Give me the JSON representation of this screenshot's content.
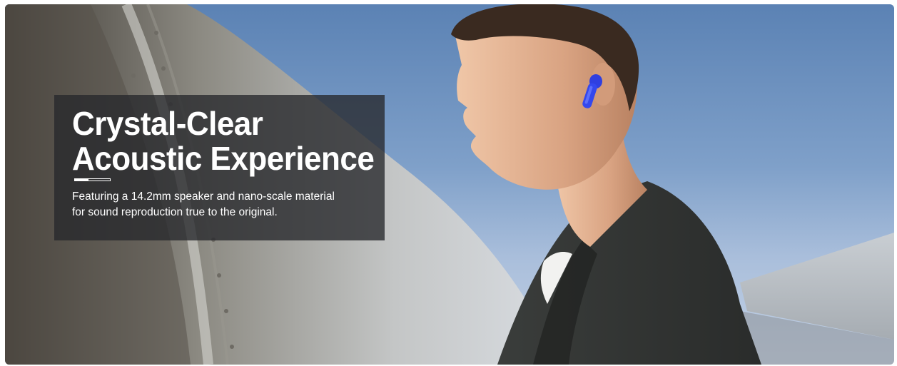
{
  "banner": {
    "headline_line1": "Crystal-Clear",
    "headline_line2": "Acoustic Experience",
    "description_line1": "Featuring a 14.2mm speaker and nano-scale material",
    "description_line2": "for sound reproduction true to the original.",
    "earbud_color": "#2f3fe0",
    "panel_color": "#26282c"
  }
}
